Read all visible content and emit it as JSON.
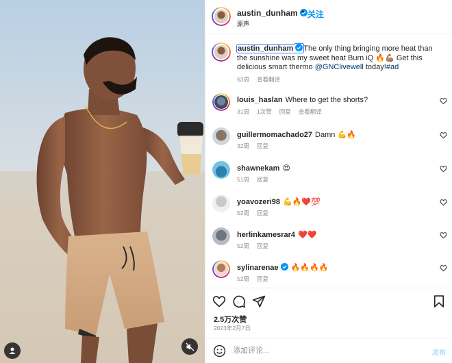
{
  "post": {
    "username": "austin_dunham",
    "follow_label": "关注",
    "separator": "•",
    "audio_label": "原声",
    "verified_icon": "verified-badge-icon"
  },
  "caption": {
    "username": "austin_dunham",
    "text_before_mention": "The only thing bringing more heat than the sunshine was my sweet heat Burn iQ 🔥💪🏽 Get this delicious smart thermo ",
    "mention": "@GNClivewell",
    "text_after_mention": " today!",
    "hashtag": "#ad",
    "time": "63周",
    "translate_label": "查看翻译"
  },
  "comments": [
    {
      "user": "louis_haslan",
      "text": "Where to get the shorts?",
      "time": "31周",
      "likes": "1次赞",
      "reply": "回复",
      "translate": "查看翻译",
      "verified": false,
      "avatar_color": "#5f7f9e"
    },
    {
      "user": "guillermomachado27",
      "text": "Damn 💪🔥",
      "time": "32周",
      "reply": "回复",
      "verified": false,
      "avatar_color": "#7c6a5a"
    },
    {
      "user": "shawnekam",
      "text": "😍",
      "time": "51周",
      "reply": "回复",
      "verified": false,
      "avatar_color": "#3fa3c8"
    },
    {
      "user": "yoavozeri98",
      "text": "💪🔥❤️💯",
      "time": "52周",
      "reply": "回复",
      "verified": false,
      "avatar_color": "#b9b9b9"
    },
    {
      "user": "herlinkamesrar4",
      "text": "❤️❤️",
      "time": "52周",
      "reply": "回复",
      "verified": false,
      "avatar_color": "#8a8f98"
    },
    {
      "user": "sylinarenae",
      "text": "🔥🔥🔥🔥",
      "time": "52周",
      "reply": "回复",
      "verified": true,
      "avatar_color": "#c98a6b"
    }
  ],
  "stats": {
    "views": "2.5万次赞",
    "date": "2023年2月7日"
  },
  "composer": {
    "placeholder": "添加评论...",
    "post_label": "发布"
  },
  "colors": {
    "accent": "#0095f6",
    "link": "#00376b",
    "muted": "#8e8e8e",
    "text": "#262626",
    "post_disabled": "#b2dffc",
    "heart_emoji": "#e0245e"
  },
  "icons": {
    "like": "heart-icon",
    "comment": "comment-bubble-icon",
    "share": "paper-plane-icon",
    "save": "bookmark-icon",
    "emoji": "smiley-icon",
    "mute": "speaker-muted-icon",
    "tagged": "person-icon"
  }
}
